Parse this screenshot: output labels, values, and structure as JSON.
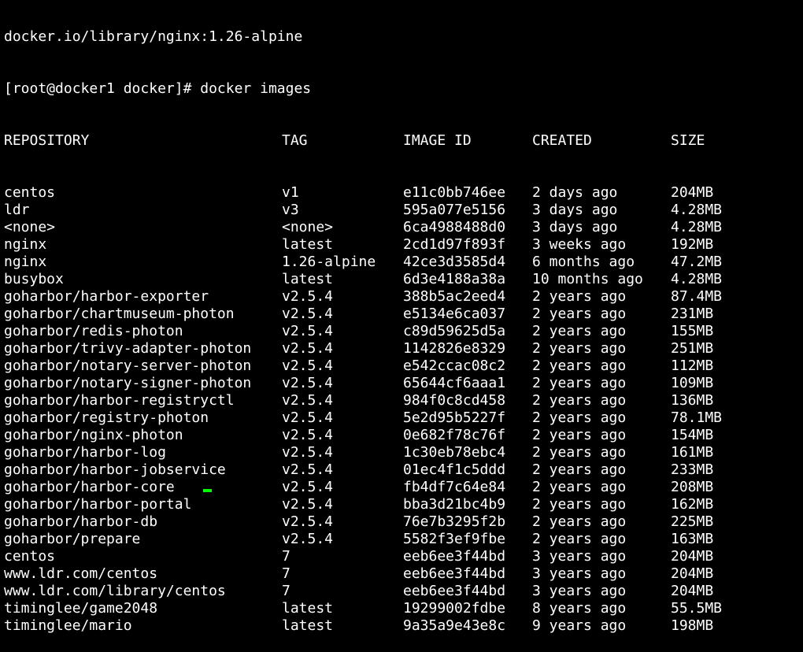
{
  "terminal": {
    "cut_line": "docker.io/library/nginx:1.26-alpine",
    "prompt": "[root@docker1 docker]# docker images",
    "headers": {
      "repository": "REPOSITORY",
      "tag": "TAG",
      "image_id": "IMAGE ID",
      "created": "CREATED",
      "size": "SIZE"
    },
    "rows": [
      {
        "repository": "centos",
        "tag": "v1",
        "image_id": "e11c0bb746ee",
        "created": "2 days ago",
        "size": "204MB"
      },
      {
        "repository": "ldr",
        "tag": "v3",
        "image_id": "595a077e5156",
        "created": "3 days ago",
        "size": "4.28MB"
      },
      {
        "repository": "<none>",
        "tag": "<none>",
        "image_id": "6ca4988488d0",
        "created": "3 days ago",
        "size": "4.28MB"
      },
      {
        "repository": "nginx",
        "tag": "latest",
        "image_id": "2cd1d97f893f",
        "created": "3 weeks ago",
        "size": "192MB"
      },
      {
        "repository": "nginx",
        "tag": "1.26-alpine",
        "image_id": "42ce3d3585d4",
        "created": "6 months ago",
        "size": "47.2MB"
      },
      {
        "repository": "busybox",
        "tag": "latest",
        "image_id": "6d3e4188a38a",
        "created": "10 months ago",
        "size": "4.28MB"
      },
      {
        "repository": "goharbor/harbor-exporter",
        "tag": "v2.5.4",
        "image_id": "388b5ac2eed4",
        "created": "2 years ago",
        "size": "87.4MB"
      },
      {
        "repository": "goharbor/chartmuseum-photon",
        "tag": "v2.5.4",
        "image_id": "e5134e6ca037",
        "created": "2 years ago",
        "size": "231MB"
      },
      {
        "repository": "goharbor/redis-photon",
        "tag": "v2.5.4",
        "image_id": "c89d59625d5a",
        "created": "2 years ago",
        "size": "155MB"
      },
      {
        "repository": "goharbor/trivy-adapter-photon",
        "tag": "v2.5.4",
        "image_id": "1142826e8329",
        "created": "2 years ago",
        "size": "251MB"
      },
      {
        "repository": "goharbor/notary-server-photon",
        "tag": "v2.5.4",
        "image_id": "e542ccac08c2",
        "created": "2 years ago",
        "size": "112MB"
      },
      {
        "repository": "goharbor/notary-signer-photon",
        "tag": "v2.5.4",
        "image_id": "65644cf6aaa1",
        "created": "2 years ago",
        "size": "109MB"
      },
      {
        "repository": "goharbor/harbor-registryctl",
        "tag": "v2.5.4",
        "image_id": "984f0c8cd458",
        "created": "2 years ago",
        "size": "136MB"
      },
      {
        "repository": "goharbor/registry-photon",
        "tag": "v2.5.4",
        "image_id": "5e2d95b5227f",
        "created": "2 years ago",
        "size": "78.1MB"
      },
      {
        "repository": "goharbor/nginx-photon",
        "tag": "v2.5.4",
        "image_id": "0e682f78c76f",
        "created": "2 years ago",
        "size": "154MB"
      },
      {
        "repository": "goharbor/harbor-log",
        "tag": "v2.5.4",
        "image_id": "1c30eb78ebc4",
        "created": "2 years ago",
        "size": "161MB"
      },
      {
        "repository": "goharbor/harbor-jobservice",
        "tag": "v2.5.4",
        "image_id": "01ec4f1c5ddd",
        "created": "2 years ago",
        "size": "233MB"
      },
      {
        "repository": "goharbor/harbor-core",
        "tag": "v2.5.4",
        "image_id": "fb4df7c64e84",
        "created": "2 years ago",
        "size": "208MB"
      },
      {
        "repository": "goharbor/harbor-portal",
        "tag": "v2.5.4",
        "image_id": "bba3d21bc4b9",
        "created": "2 years ago",
        "size": "162MB"
      },
      {
        "repository": "goharbor/harbor-db",
        "tag": "v2.5.4",
        "image_id": "76e7b3295f2b",
        "created": "2 years ago",
        "size": "225MB"
      },
      {
        "repository": "goharbor/prepare",
        "tag": "v2.5.4",
        "image_id": "5582f3ef9fbe",
        "created": "2 years ago",
        "size": "163MB"
      },
      {
        "repository": "centos",
        "tag": "7",
        "image_id": "eeb6ee3f44bd",
        "created": "3 years ago",
        "size": "204MB"
      },
      {
        "repository": "www.ldr.com/centos",
        "tag": "7",
        "image_id": "eeb6ee3f44bd",
        "created": "3 years ago",
        "size": "204MB"
      },
      {
        "repository": "www.ldr.com/library/centos",
        "tag": "7",
        "image_id": "eeb6ee3f44bd",
        "created": "3 years ago",
        "size": "204MB"
      },
      {
        "repository": "timinglee/game2048",
        "tag": "latest",
        "image_id": "19299002fdbe",
        "created": "8 years ago",
        "size": "55.5MB"
      },
      {
        "repository": "timinglee/mario",
        "tag": "latest",
        "image_id": "9a35a9e43e8c",
        "created": "9 years ago",
        "size": "198MB"
      }
    ],
    "colors": {
      "background": "#000000",
      "foreground": "#ffffff",
      "cursor": "#00ff00"
    }
  }
}
